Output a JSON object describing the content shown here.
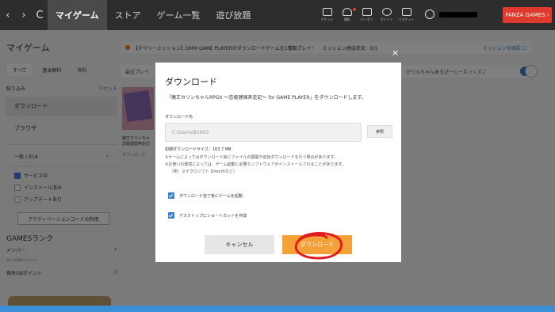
{
  "nav": {
    "back": "‹",
    "forward": "›",
    "reload": "C",
    "tabs": [
      "マイゲーム",
      "ストア",
      "ゲーム一覧",
      "遊び放題"
    ],
    "tools": [
      {
        "icon": "ticket-icon",
        "label": "チケット"
      },
      {
        "icon": "bell-icon",
        "label": "通知"
      },
      {
        "icon": "coupon-icon",
        "label": "クーポン"
      },
      {
        "icon": "point-icon",
        "label": "ポイント"
      },
      {
        "icon": "cart-icon",
        "label": "バスケット"
      }
    ],
    "fanza_label": "FANZA GAMES ›",
    "chevron": "⌄"
  },
  "sidebar": {
    "title": "マイゲーム",
    "tabs": [
      "すべて",
      "基本無料",
      "有料"
    ],
    "filter_label": "絞り込み",
    "reset_label": "リセット",
    "items": [
      "ダウンロード",
      "ブラウザ"
    ],
    "rating_label": "一般 / R18",
    "rating_chevron": "⌄",
    "checks": [
      {
        "label": "サービス中",
        "checked": true
      },
      {
        "label": "インストール済み",
        "checked": false
      },
      {
        "label": "アップデートあり",
        "checked": false
      }
    ],
    "activation_button": "アクティベーションコードの利用",
    "rank_title": "GAMESランク",
    "member_label": "メンバー",
    "rank_note": "あと200RPでペテラン",
    "points_label": "保有GBポイント",
    "points_value": "0"
  },
  "main": {
    "mission_text": "【デイリーミッション】DMM GAME PLAYERのダウンロードゲームを1種類プレイ！",
    "mission_status": "ミッション達成状況：0/1",
    "mission_link": "ミッションを確認 ☐",
    "search_left": "最近プレイ",
    "search_placeholder": "かりんちゃんあるぴーじーえっくすこ",
    "game_title": "魔王カリンちゃ 恋姫建国奔走記",
    "game_sub": "ダウンロード"
  },
  "dialog": {
    "title": "ダウンロード",
    "close": "×",
    "message": "「魔王カリンちゃんRPGX 〜恋姫建国奔走記〜 for GAME PLAYER」をダウンロードします。",
    "dest_label": "ダウンロード先",
    "path_value": "C:\\Users\\81803",
    "browse_label": "参照",
    "size_text": "初期ダウンロードサイズ：163.7 MB",
    "notes": [
      "※ゲームによってはダウンロード後にファイルの展開や追加ダウンロードを行う場合があります。",
      "※お使いの環境によっては、ゲーム起動に必要なソフトウェアがインストールされることがあります。",
      "（例：マイクロソフト DirectXなど）"
    ],
    "option_launch": "ダウンロード完了後にゲームを起動",
    "option_shortcut": "デスクトップにショートカットを作成",
    "cancel_label": "キャンセル",
    "download_label": "ダウンロード"
  },
  "colors": {
    "accent": "#f4a13a",
    "annotation": "#e21b1b",
    "check": "#3b7fd3"
  }
}
